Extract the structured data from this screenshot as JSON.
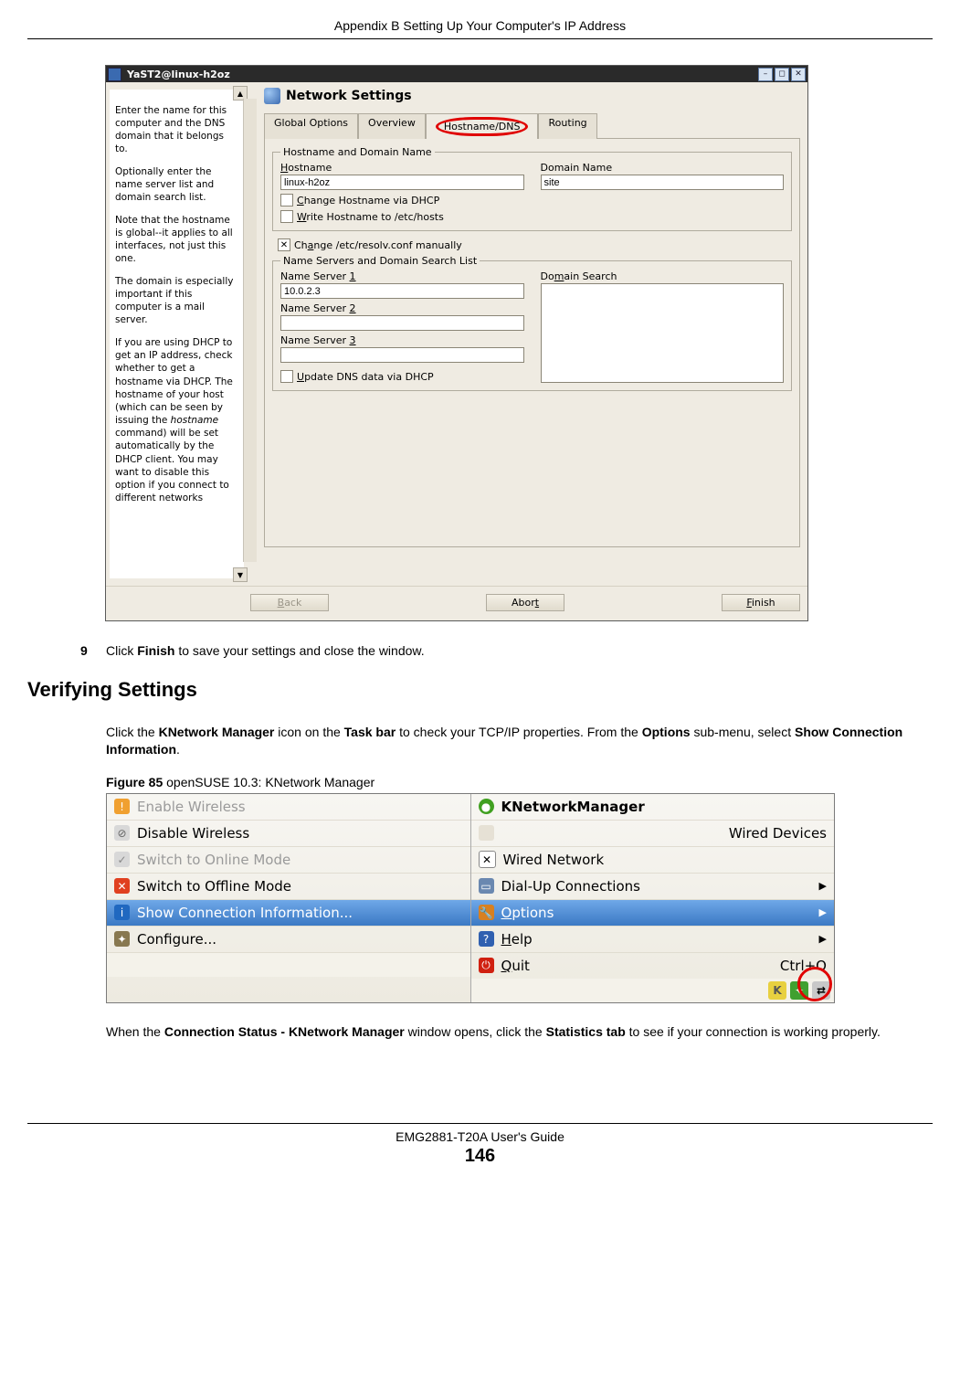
{
  "header": "Appendix B Setting Up Your Computer's IP Address",
  "yast": {
    "title": "YaST2@linux-h2oz",
    "section_title": "Network Settings",
    "tabs": {
      "global": "Global Options",
      "overview": "Overview",
      "hostdns": "Hostname/DNS",
      "routing": "Routing"
    },
    "group1_legend": "Hostname and Domain Name",
    "hostname_label": "Hostname",
    "hostname_value": "linux-h2oz",
    "domain_label": "Domain Name",
    "domain_value": "site",
    "chk_change_dhcp": "Change Hostname via DHCP",
    "chk_write_hosts": "Write Hostname to /etc/hosts",
    "chk_resolv": "Change /etc/resolv.conf manually",
    "group2_legend": "Name Servers and Domain Search List",
    "ns1_label": "Name Server 1",
    "ns1_value": "10.0.2.3",
    "ns2_label": "Name Server 2",
    "ns3_label": "Name Server 3",
    "domsearch_label": "Domain Search",
    "chk_update_dns": "Update DNS data via DHCP",
    "btn_back": "Back",
    "btn_abort": "Abort",
    "btn_finish": "Finish",
    "help": {
      "p1": "Enter the name for this computer and the DNS domain that it belongs to.",
      "p2": "Optionally enter the name server list and domain search list.",
      "p3a": "Note that the hostname is global--it applies to all interfaces, not just this one.",
      "p4": "The domain is especially important if this computer is a mail server.",
      "p5a": "If you are using DHCP to get an IP address, check whether to get a hostname via DHCP. The hostname of your host (which can be seen by issuing the ",
      "p5b": "hostname",
      "p5c": " command) will be set automatically by the DHCP client. You may want to disable this option if you connect to different networks"
    }
  },
  "step9": {
    "num": "9",
    "pre": "Click ",
    "bold": "Finish",
    "post": " to save your settings and close the window."
  },
  "h2": "Verifying Settings",
  "para1": {
    "a": "Click the ",
    "b1": "KNetwork Manager",
    "c": " icon on the ",
    "b2": "Task bar",
    "d": " to check your TCP/IP properties. From the ",
    "b3": "Options",
    "e": " sub-menu, select ",
    "b4": "Show Connection Information",
    "f": "."
  },
  "figcap": {
    "label": "Figure 85",
    "text": "   openSUSE 10.3: KNetwork Manager"
  },
  "knm": {
    "left": {
      "enable": "Enable Wireless",
      "disable": "Disable Wireless",
      "online": "Switch to Online Mode",
      "offline": "Switch to Offline Mode",
      "show": "Show Connection Information...",
      "configure": "Configure..."
    },
    "right": {
      "title": "KNetworkManager",
      "wired_dev": "Wired Devices",
      "wired_net": "Wired Network",
      "dial": "Dial-Up Connections",
      "options": "Options",
      "help": "Help",
      "quit": "Quit",
      "quit_sc": "Ctrl+Q"
    }
  },
  "para2": {
    "a": "When the ",
    "b1": "Connection Status - KNetwork Manager",
    "b": " window opens, click the ",
    "b2": "Statistics tab",
    "c": " to see if your connection is working properly."
  },
  "footer": {
    "guide": "EMG2881-T20A User's Guide",
    "page": "146"
  }
}
